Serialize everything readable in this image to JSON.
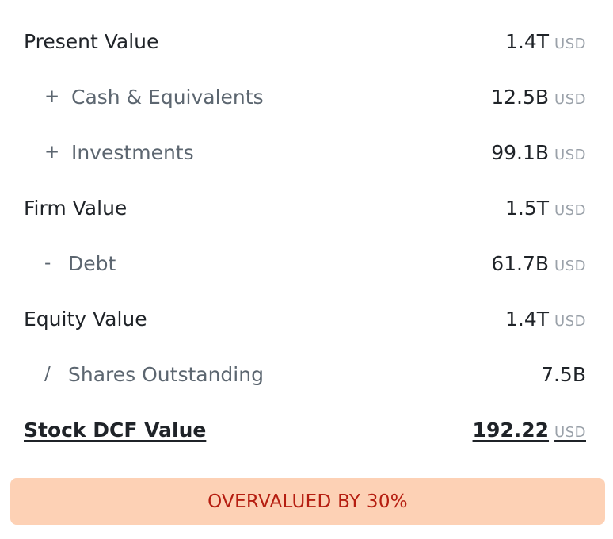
{
  "rows": [
    {
      "op": "",
      "label": "Present Value",
      "value": "1.4T",
      "unit": "USD"
    },
    {
      "op": "+",
      "label": "Cash & Equivalents",
      "value": "12.5B",
      "unit": "USD"
    },
    {
      "op": "+",
      "label": "Investments",
      "value": "99.1B",
      "unit": "USD"
    },
    {
      "op": "",
      "label": "Firm Value",
      "value": "1.5T",
      "unit": "USD"
    },
    {
      "op": "-",
      "label": "Debt",
      "value": "61.7B",
      "unit": "USD"
    },
    {
      "op": "",
      "label": "Equity Value",
      "value": "1.4T",
      "unit": "USD"
    },
    {
      "op": "/",
      "label": "Shares Outstanding",
      "value": "7.5B",
      "unit": ""
    }
  ],
  "total": {
    "label": "Stock DCF Value",
    "value": "192.22",
    "unit": "USD"
  },
  "verdict": {
    "text": "OVERVALUED BY 30%",
    "bg_color": "#fdd1b5",
    "text_color": "#b51d10"
  }
}
